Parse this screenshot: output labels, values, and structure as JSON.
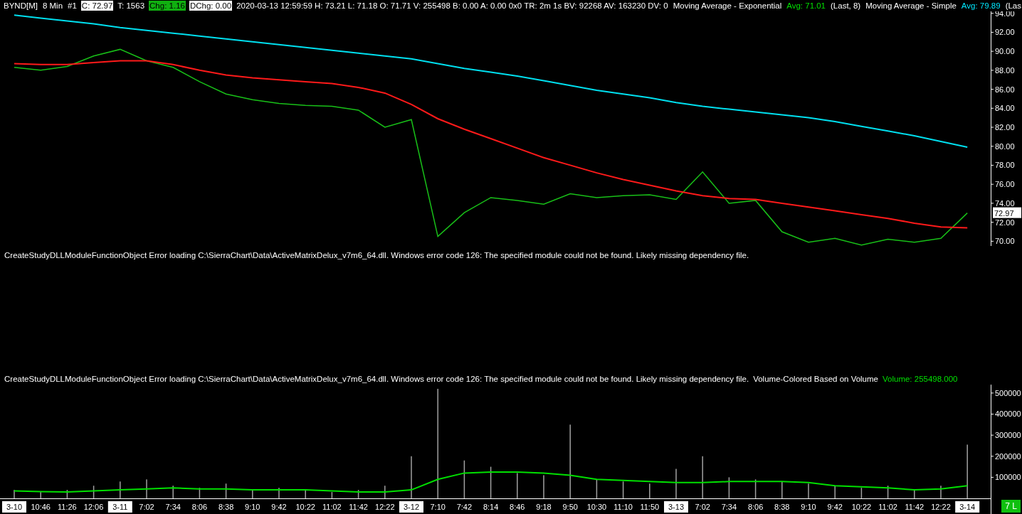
{
  "header": [
    {
      "text": "BYND[M]",
      "kind": "plain"
    },
    {
      "text": "8 Min",
      "kind": "plain"
    },
    {
      "text": "#1",
      "kind": "plain"
    },
    {
      "text": "C: 72.97",
      "kind": "boxed"
    },
    {
      "text": "T: 1563",
      "kind": "plain"
    },
    {
      "text": "Chg: 1.16",
      "kind": "highlight"
    },
    {
      "text": "DChg: 0.00",
      "kind": "boxed"
    },
    {
      "text": "2020-03-13 12:59:59 H: 73.21 L: 71.18 O: 71.71 V: 255498 B: 0.00 A: 0.00 0x0 TR: 2m 1s BV: 92268 AV: 163230 DV: 0",
      "kind": "plain"
    },
    {
      "text": "Moving Average - Exponential",
      "kind": "plain"
    },
    {
      "text": "Avg: 71.01",
      "kind": "plain",
      "color": "#00e000"
    },
    {
      "text": "(Last, 8)",
      "kind": "plain"
    },
    {
      "text": "Moving Average - Simple",
      "kind": "plain"
    },
    {
      "text": "Avg: 79.89",
      "kind": "plain",
      "color": "#00e8ff"
    },
    {
      "text": "(Las",
      "kind": "plain"
    }
  ],
  "price_chart": {
    "last_price": "72.97",
    "chart_data": {
      "type": "line",
      "ylim": [
        69.5,
        94.2
      ],
      "yticks": [
        {
          "value": 70,
          "label": "70.00"
        },
        {
          "value": 72,
          "label": "72.00"
        },
        {
          "value": 74,
          "label": "74.00"
        },
        {
          "value": 76,
          "label": "76.00"
        },
        {
          "value": 78,
          "label": "78.00"
        },
        {
          "value": 80,
          "label": "80.00"
        },
        {
          "value": 82,
          "label": "82.00"
        },
        {
          "value": 84,
          "label": "84.00"
        },
        {
          "value": 86,
          "label": "86.00"
        },
        {
          "value": 88,
          "label": "88.00"
        },
        {
          "value": 90,
          "label": "90.00"
        },
        {
          "value": 92,
          "label": "92.00"
        },
        {
          "value": 94,
          "label": "94.00"
        }
      ],
      "series": [
        {
          "color": "#18c018",
          "values": [
            88.3,
            88.0,
            88.4,
            89.5,
            90.2,
            89.0,
            88.3,
            86.8,
            85.5,
            84.9,
            84.5,
            84.3,
            84.2,
            83.8,
            82.0,
            82.8,
            70.5,
            73.0,
            74.6,
            74.3,
            73.9,
            75.0,
            74.6,
            74.8,
            74.9,
            74.4,
            77.3,
            74.0,
            74.3,
            71.0,
            69.9,
            70.3,
            69.6,
            70.2,
            69.9,
            70.3,
            72.97
          ]
        },
        {
          "color": "#00e0f0",
          "values": [
            93.8,
            93.5,
            93.2,
            92.9,
            92.5,
            92.2,
            91.9,
            91.6,
            91.3,
            91.0,
            90.7,
            90.4,
            90.1,
            89.8,
            89.5,
            89.2,
            88.7,
            88.2,
            87.8,
            87.4,
            86.9,
            86.4,
            85.9,
            85.5,
            85.1,
            84.6,
            84.2,
            83.9,
            83.6,
            83.3,
            83.0,
            82.6,
            82.1,
            81.6,
            81.1,
            80.5,
            79.9
          ]
        },
        {
          "color": "#ff1a1a",
          "values": [
            88.7,
            88.6,
            88.6,
            88.8,
            89.0,
            89.0,
            88.6,
            88.0,
            87.5,
            87.2,
            87.0,
            86.8,
            86.6,
            86.2,
            85.6,
            84.4,
            82.9,
            81.8,
            80.8,
            79.8,
            78.8,
            78.0,
            77.2,
            76.5,
            75.9,
            75.3,
            74.8,
            74.5,
            74.4,
            74.0,
            73.6,
            73.2,
            72.8,
            72.4,
            71.9,
            71.5,
            71.4
          ]
        }
      ]
    }
  },
  "price_message": "CreateStudyDLLModuleFunctionObject Error loading C:\\SierraChart\\Data\\ActiveMatrixDelux_v7m6_64.dll. Windows error code 126: The specified module could not be found. Likely missing dependency file.",
  "volume_legend": [
    {
      "text": "CreateStudyDLLModuleFunctionObject Error loading C:\\SierraChart\\Data\\ActiveMatrixDelux_v7m6_64.dll. Windows error code 126: The specified module could not be found. Likely missing dependency file."
    },
    {
      "text": "Volume-Colored Based on Volume"
    },
    {
      "text": "Volume: 255498.000",
      "color": "#00e000"
    }
  ],
  "volume_chart": {
    "chart_data": {
      "type": "bar",
      "ylim": [
        0,
        540000
      ],
      "yticks": [
        {
          "value": 100000,
          "label": "100000"
        },
        {
          "value": 200000,
          "label": "200000"
        },
        {
          "value": 300000,
          "label": "300000"
        },
        {
          "value": 400000,
          "label": "400000"
        },
        {
          "value": 500000,
          "label": "500000"
        }
      ],
      "series": [
        {
          "color": "#a0a0a0",
          "values": [
            40000,
            30000,
            40000,
            60000,
            80000,
            90000,
            60000,
            50000,
            70000,
            40000,
            50000,
            40000,
            30000,
            40000,
            60000,
            200000,
            520000,
            180000,
            150000,
            120000,
            110000,
            350000,
            90000,
            80000,
            70000,
            140000,
            200000,
            100000,
            90000,
            80000,
            70000,
            60000,
            50000,
            60000,
            40000,
            60000,
            255000
          ]
        },
        {
          "type": "line",
          "color": "#00e000",
          "values": [
            35000,
            32000,
            30000,
            35000,
            40000,
            45000,
            50000,
            45000,
            45000,
            40000,
            40000,
            40000,
            35000,
            30000,
            30000,
            40000,
            90000,
            120000,
            125000,
            125000,
            120000,
            110000,
            90000,
            85000,
            80000,
            75000,
            75000,
            80000,
            80000,
            80000,
            75000,
            60000,
            55000,
            50000,
            40000,
            45000,
            60000
          ]
        }
      ]
    }
  },
  "time_axis": [
    {
      "label": "3-10",
      "kind": "date"
    },
    {
      "label": "10:46",
      "kind": "time"
    },
    {
      "label": "11:26",
      "kind": "time"
    },
    {
      "label": "12:06",
      "kind": "time"
    },
    {
      "label": "3-11",
      "kind": "date"
    },
    {
      "label": "7:02",
      "kind": "time"
    },
    {
      "label": "7:34",
      "kind": "time"
    },
    {
      "label": "8:06",
      "kind": "time"
    },
    {
      "label": "8:38",
      "kind": "time"
    },
    {
      "label": "9:10",
      "kind": "time"
    },
    {
      "label": "9:42",
      "kind": "time"
    },
    {
      "label": "10:22",
      "kind": "time"
    },
    {
      "label": "11:02",
      "kind": "time"
    },
    {
      "label": "11:42",
      "kind": "time"
    },
    {
      "label": "12:22",
      "kind": "time"
    },
    {
      "label": "3-12",
      "kind": "date"
    },
    {
      "label": "7:10",
      "kind": "time"
    },
    {
      "label": "7:42",
      "kind": "time"
    },
    {
      "label": "8:14",
      "kind": "time"
    },
    {
      "label": "8:46",
      "kind": "time"
    },
    {
      "label": "9:18",
      "kind": "time"
    },
    {
      "label": "9:50",
      "kind": "time"
    },
    {
      "label": "10:30",
      "kind": "time"
    },
    {
      "label": "11:10",
      "kind": "time"
    },
    {
      "label": "11:50",
      "kind": "time"
    },
    {
      "label": "3-13",
      "kind": "date"
    },
    {
      "label": "7:02",
      "kind": "time"
    },
    {
      "label": "7:34",
      "kind": "time"
    },
    {
      "label": "8:06",
      "kind": "time"
    },
    {
      "label": "8:38",
      "kind": "time"
    },
    {
      "label": "9:10",
      "kind": "time"
    },
    {
      "label": "9:42",
      "kind": "time"
    },
    {
      "label": "10:22",
      "kind": "time"
    },
    {
      "label": "11:02",
      "kind": "time"
    },
    {
      "label": "11:42",
      "kind": "time"
    },
    {
      "label": "12:22",
      "kind": "time"
    },
    {
      "label": "3-14",
      "kind": "date"
    }
  ],
  "status_badge": "7 L"
}
